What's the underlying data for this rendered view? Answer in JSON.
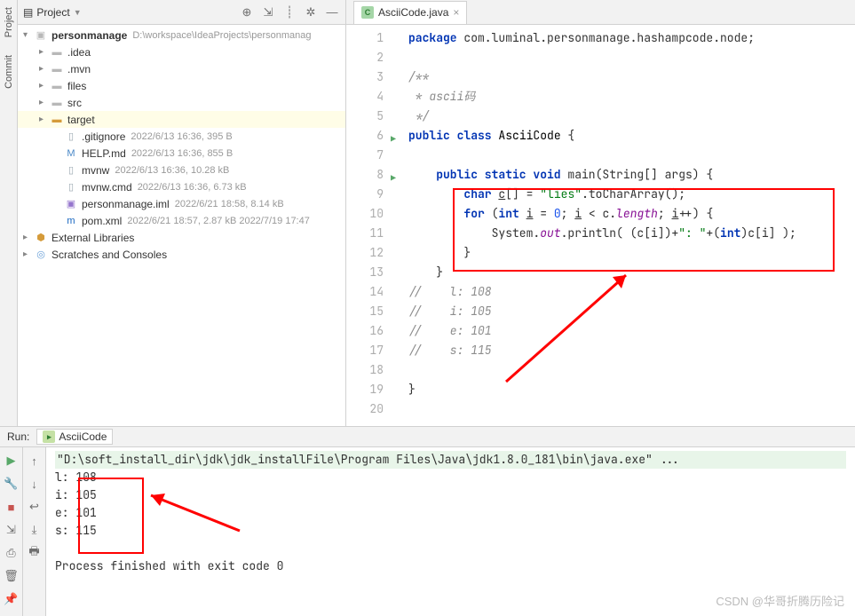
{
  "sidebar": {
    "tabs": [
      "Project",
      "Commit"
    ]
  },
  "projectPanel": {
    "title": "Project",
    "toolbar": [
      "target",
      "expand",
      "divider",
      "settings",
      "hide"
    ]
  },
  "tree": {
    "root": {
      "name": "personmanage",
      "path": "D:\\workspace\\IdeaProjects\\personmanag"
    },
    "items": [
      {
        "name": ".idea",
        "type": "folder"
      },
      {
        "name": ".mvn",
        "type": "folder"
      },
      {
        "name": "files",
        "type": "folder"
      },
      {
        "name": "src",
        "type": "folder"
      },
      {
        "name": "target",
        "type": "folder-open"
      },
      {
        "name": ".gitignore",
        "meta": "2022/6/13 16:36, 395 B",
        "type": "file"
      },
      {
        "name": "HELP.md",
        "meta": "2022/6/13 16:36, 855 B",
        "type": "md"
      },
      {
        "name": "mvnw",
        "meta": "2022/6/13 16:36, 10.28 kB",
        "type": "file"
      },
      {
        "name": "mvnw.cmd",
        "meta": "2022/6/13 16:36, 6.73 kB",
        "type": "file"
      },
      {
        "name": "personmanage.iml",
        "meta": "2022/6/21 18:58, 8.14 kB",
        "type": "iml"
      },
      {
        "name": "pom.xml",
        "meta": "2022/6/21 18:57, 2.87 kB 2022/7/19 17:47",
        "type": "pom"
      }
    ],
    "externals": "External Libraries",
    "scratches": "Scratches and Consoles"
  },
  "editor": {
    "tabName": "AsciiCode.java",
    "lines": [
      {
        "n": 1,
        "html": "<span class='kw'>package</span> com.luminal.personmanage.hashampcode.node;"
      },
      {
        "n": 2,
        "html": ""
      },
      {
        "n": 3,
        "html": "<span class='com'>/**</span>"
      },
      {
        "n": 4,
        "html": "<span class='com'> * ascii码</span>"
      },
      {
        "n": 5,
        "html": "<span class='com'> */</span>"
      },
      {
        "n": 6,
        "html": "<span class='kw'>public class</span> <span class='cls'>AsciiCode</span> {",
        "run": true
      },
      {
        "n": 7,
        "html": ""
      },
      {
        "n": 8,
        "html": "    <span class='kw'>public static void</span> main(String[] args) {",
        "run": true
      },
      {
        "n": 9,
        "html": "        <span class='kw'>char</span> <u>c</u>[] = <span class='str'>\"lies\"</span>.toCharArray();"
      },
      {
        "n": 10,
        "html": "        <span class='kw'>for</span> (<span class='kw'>int</span> <u>i</u> = <span class='num'>0</span>; <u>i</u> &lt; c.<span class='field'>length</span>; <u>i</u>++) {"
      },
      {
        "n": 11,
        "html": "            System.<span class='field'>out</span>.println( (c[i])+<span class='str'>\": \"</span>+(<span class='kw'>int</span>)c[i] );"
      },
      {
        "n": 12,
        "html": "        }"
      },
      {
        "n": 13,
        "html": "    }"
      },
      {
        "n": 14,
        "html": "<span class='com'>//    l: 108</span>"
      },
      {
        "n": 15,
        "html": "<span class='com'>//    i: 105</span>"
      },
      {
        "n": 16,
        "html": "<span class='com'>//    e: 101</span>"
      },
      {
        "n": 17,
        "html": "<span class='com'>//    s: 115</span>"
      },
      {
        "n": 18,
        "html": ""
      },
      {
        "n": 19,
        "html": "}"
      },
      {
        "n": 20,
        "html": ""
      }
    ]
  },
  "run": {
    "title": "Run:",
    "config": "AsciiCode",
    "cmd": "\"D:\\soft_install_dir\\jdk\\jdk_installFile\\Program Files\\Java\\jdk1.8.0_181\\bin\\java.exe\" ...",
    "output": [
      "l: 108",
      "i: 105",
      "e: 101",
      "s: 115"
    ],
    "exit": "Process finished with exit code 0"
  },
  "watermark": "CSDN @华哥折腾历险记"
}
